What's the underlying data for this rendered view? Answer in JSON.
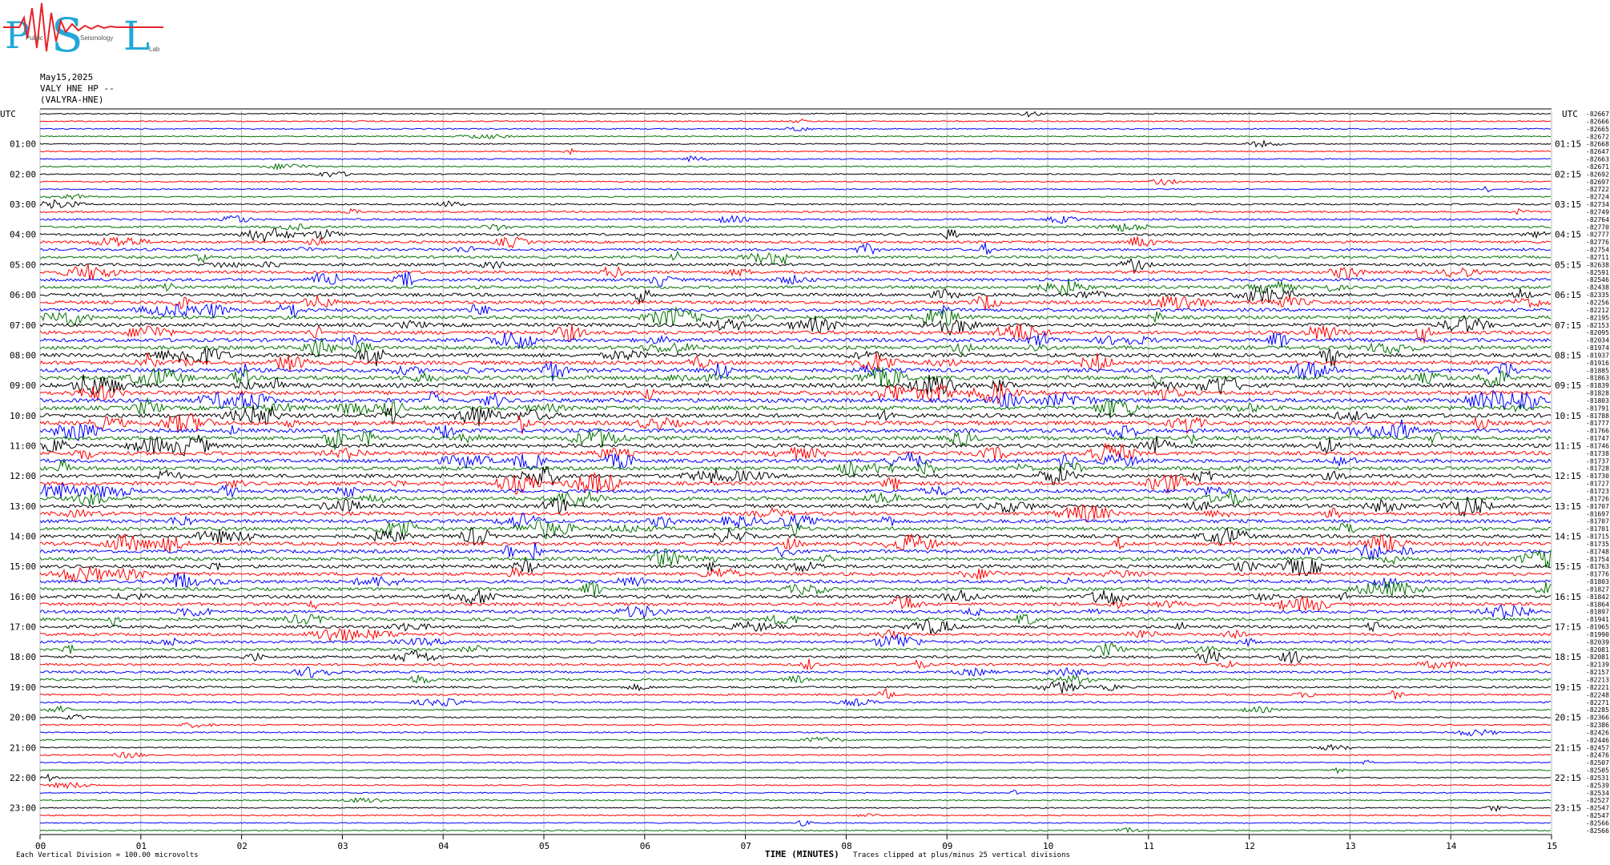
{
  "logo": {
    "letters": [
      "P",
      "S",
      "L"
    ],
    "small_words": [
      "Public",
      "Seismology",
      "Lab"
    ],
    "colors": {
      "letters": "#22a7d8",
      "trace": "#e8232a"
    }
  },
  "header": {
    "date": "May15,2025",
    "station": "VALY HNE HP --",
    "code": "(VALYRA-HNE)"
  },
  "chart_data": {
    "type": "line",
    "title": "",
    "left_axis_label": "UTC",
    "right_axis_label": "UTC",
    "left_hour_labels": [
      "01:00",
      "02:00",
      "03:00",
      "04:00",
      "05:00",
      "06:00",
      "07:00",
      "08:00",
      "09:00",
      "10:00",
      "11:00",
      "12:00",
      "13:00",
      "14:00",
      "15:00",
      "16:00",
      "17:00",
      "18:00",
      "19:00",
      "20:00",
      "21:00",
      "22:00",
      "23:00"
    ],
    "right_hour_labels": [
      "01:15",
      "02:15",
      "03:15",
      "04:15",
      "05:15",
      "06:15",
      "07:15",
      "08:15",
      "09:15",
      "10:15",
      "11:15",
      "12:15",
      "13:15",
      "14:15",
      "15:15",
      "16:15",
      "17:15",
      "18:15",
      "19:15",
      "20:15",
      "21:15",
      "22:15",
      "23:15"
    ],
    "x_ticks": [
      "00",
      "01",
      "02",
      "03",
      "04",
      "05",
      "06",
      "07",
      "08",
      "09",
      "10",
      "11",
      "12",
      "13",
      "14",
      "15"
    ],
    "xlabel": "TIME (MINUTES)",
    "xlim": [
      0,
      15
    ],
    "trace_colors": [
      "#000000",
      "#ff0000",
      "#0000ff",
      "#007000"
    ],
    "trace_minutes": 15,
    "trace_count": 96,
    "activity_level": [
      0.5,
      0.6,
      0.5,
      0.5,
      0.5,
      0.5,
      0.5,
      0.7,
      0.6,
      0.6,
      0.6,
      0.7,
      1.2,
      1.6,
      1.8,
      2.2,
      2.6,
      2.8,
      3.0,
      3.0,
      3.2,
      3.4,
      3.8,
      3.8,
      4.0,
      4.2,
      4.2,
      4.4,
      4.6,
      4.6,
      4.8,
      4.8,
      5.0,
      5.2,
      5.4,
      5.4,
      5.6,
      5.6,
      5.6,
      5.6,
      5.4,
      5.4,
      5.2,
      5.2,
      5.0,
      5.0,
      4.8,
      4.8,
      4.8,
      4.8,
      4.6,
      4.6,
      4.6,
      4.6,
      4.6,
      4.6,
      4.4,
      4.4,
      4.4,
      4.4,
      4.2,
      4.2,
      4.2,
      4.0,
      4.0,
      4.0,
      3.8,
      3.8,
      3.6,
      3.4,
      3.2,
      3.0,
      2.8,
      2.6,
      2.4,
      2.2,
      2.0,
      1.8,
      1.6,
      1.2,
      1.0,
      0.9,
      0.8,
      0.8,
      0.7,
      0.7,
      0.7,
      0.6,
      0.6,
      0.6,
      0.6,
      0.6,
      0.6,
      0.6,
      0.5,
      0.5
    ],
    "right_values": [
      "-82667",
      "-82666",
      "-82665",
      "-82672",
      "-82668",
      "-82647",
      "-82663",
      "-82671",
      "-82692",
      "-82697",
      "-82722",
      "-82724",
      "-82734",
      "-82749",
      "-82764",
      "-82770",
      "-82777",
      "-82776",
      "-82754",
      "-82711",
      "-82638",
      "-82591",
      "-82546",
      "-82438",
      "-82335",
      "-82256",
      "-82212",
      "-82195",
      "-82153",
      "-82095",
      "-82034",
      "-81974",
      "-81937",
      "-81916",
      "-81885",
      "-81863",
      "-81839",
      "-81828",
      "-81803",
      "-81791",
      "-81788",
      "-81777",
      "-81766",
      "-81747",
      "-81746",
      "-81738",
      "-81737",
      "-81728",
      "-81730",
      "-81727",
      "-81723",
      "-81726",
      "-81707",
      "-81697",
      "-81707",
      "-81701",
      "-81715",
      "-81735",
      "-81748",
      "-81754",
      "-81763",
      "-81776",
      "-81803",
      "-81827",
      "-81842",
      "-81864",
      "-81897",
      "-81941",
      "-81965",
      "-81990",
      "-82039",
      "-82081",
      "-82081",
      "-82139",
      "-82157",
      "-82213",
      "-82221",
      "-82248",
      "-82271",
      "-82285",
      "-82366",
      "-82386",
      "-82426",
      "-82446",
      "-82457",
      "-82476",
      "-82507",
      "-82505",
      "-82531",
      "-82539",
      "-82534",
      "-82527",
      "-82547",
      "-82547",
      "-82566",
      "-82566"
    ]
  },
  "footer": {
    "division_note": "Each Vertical Division = 100.00 microvolts",
    "clip_note": "Traces clipped at plus/minus 25 vertical divisions"
  }
}
